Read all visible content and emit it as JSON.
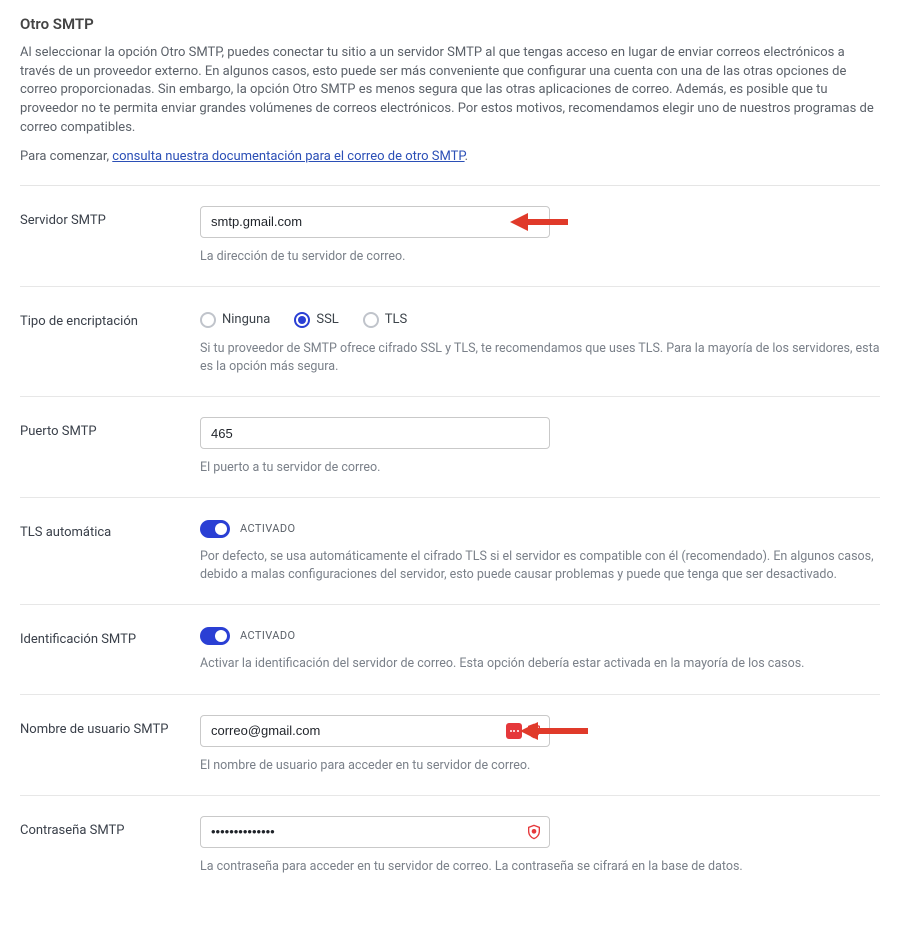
{
  "heading": "Otro SMTP",
  "intro_text": "Al seleccionar la opción Otro SMTP, puedes conectar tu sitio a un servidor SMTP al que tengas acceso en lugar de enviar correos electrónicos a través de un proveedor externo. En algunos casos, esto puede ser más conveniente que configurar una cuenta con una de las otras opciones de correo proporcionadas. Sin embargo, la opción Otro SMTP es menos segura que las otras aplicaciones de correo. Además, es posible que tu proveedor no te permita enviar grandes volúmenes de correos electrónicos. Por estos motivos, recomendamos elegir uno de nuestros programas de correo compatibles.",
  "doc_prefix": "Para comenzar, ",
  "doc_link_text": "consulta nuestra documentación para el correo de otro SMTP",
  "fields": {
    "smtp_host": {
      "label": "Servidor SMTP",
      "value": "smtp.gmail.com",
      "help": "La dirección de tu servidor de correo."
    },
    "encryption": {
      "label": "Tipo de encriptación",
      "options": {
        "none": "Ninguna",
        "ssl": "SSL",
        "tls": "TLS"
      },
      "help": "Si tu proveedor de SMTP ofrece cifrado SSL y TLS, te recomendamos que uses TLS. Para la mayoría de los servidores, esta es la opción más segura."
    },
    "smtp_port": {
      "label": "Puerto SMTP",
      "value": "465",
      "help": "El puerto a tu servidor de correo."
    },
    "auto_tls": {
      "label": "TLS automática",
      "state": "ACTIVADO",
      "help": "Por defecto, se usa automáticamente el cifrado TLS si el servidor es compatible con él (recomendado). En algunos casos, debido a malas configuraciones del servidor, esto puede causar problemas y puede que tenga que ser desactivado."
    },
    "smtp_auth": {
      "label": "Identificación SMTP",
      "state": "ACTIVADO",
      "help": "Activar la identificación del servidor de correo. Esta opción debería estar activada en la mayoría de los casos."
    },
    "smtp_user": {
      "label": "Nombre de usuario SMTP",
      "value": "correo@gmail.com",
      "help": "El nombre de usuario para acceder en tu servidor de correo."
    },
    "smtp_pass": {
      "label": "Contraseña SMTP",
      "value": "••••••••••••••",
      "help": "La contraseña para acceder en tu servidor de correo. La contraseña se cifrará en la base de datos."
    }
  }
}
